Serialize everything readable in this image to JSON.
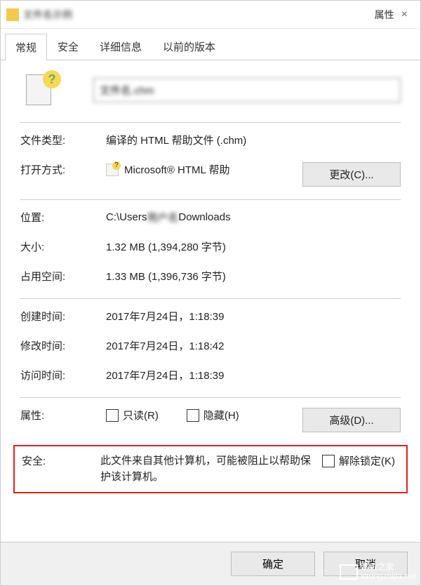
{
  "titlebar": {
    "filename_blur": "文件名示例",
    "suffix": "属性",
    "close": "×"
  },
  "tabs": {
    "general": "常规",
    "security": "安全",
    "details": "详细信息",
    "previous": "以前的版本"
  },
  "file": {
    "name_blur": "文件名.chm"
  },
  "labels": {
    "filetype": "文件类型:",
    "openwith": "打开方式:",
    "location": "位置:",
    "size": "大小:",
    "sizeondisk": "占用空间:",
    "created": "创建时间:",
    "modified": "修改时间:",
    "accessed": "访问时间:",
    "attributes": "属性:",
    "security": "安全:"
  },
  "values": {
    "filetype": "编译的 HTML 帮助文件 (.chm)",
    "openwith": "Microsoft® HTML 帮助",
    "location_prefix": "C:\\Users",
    "location_blur": "用户名",
    "location_suffix": "Downloads",
    "size": "1.32 MB (1,394,280 字节)",
    "sizeondisk": "1.33 MB (1,396,736 字节)",
    "created": "2017年7月24日，1:18:39",
    "modified": "2017年7月24日，1:18:42",
    "accessed": "2017年7月24日，1:18:39"
  },
  "buttons": {
    "change": "更改(C)...",
    "advanced": "高级(D)...",
    "ok": "确定",
    "cancel": "取消"
  },
  "checkboxes": {
    "readonly": "只读(R)",
    "hidden": "隐藏(H)",
    "unlock": "解除锁定(K)"
  },
  "security_desc": "此文件来自其他计算机，可能被阻止以帮助保护该计算机。",
  "watermark": "系统之家\nxitongzhijia.net"
}
